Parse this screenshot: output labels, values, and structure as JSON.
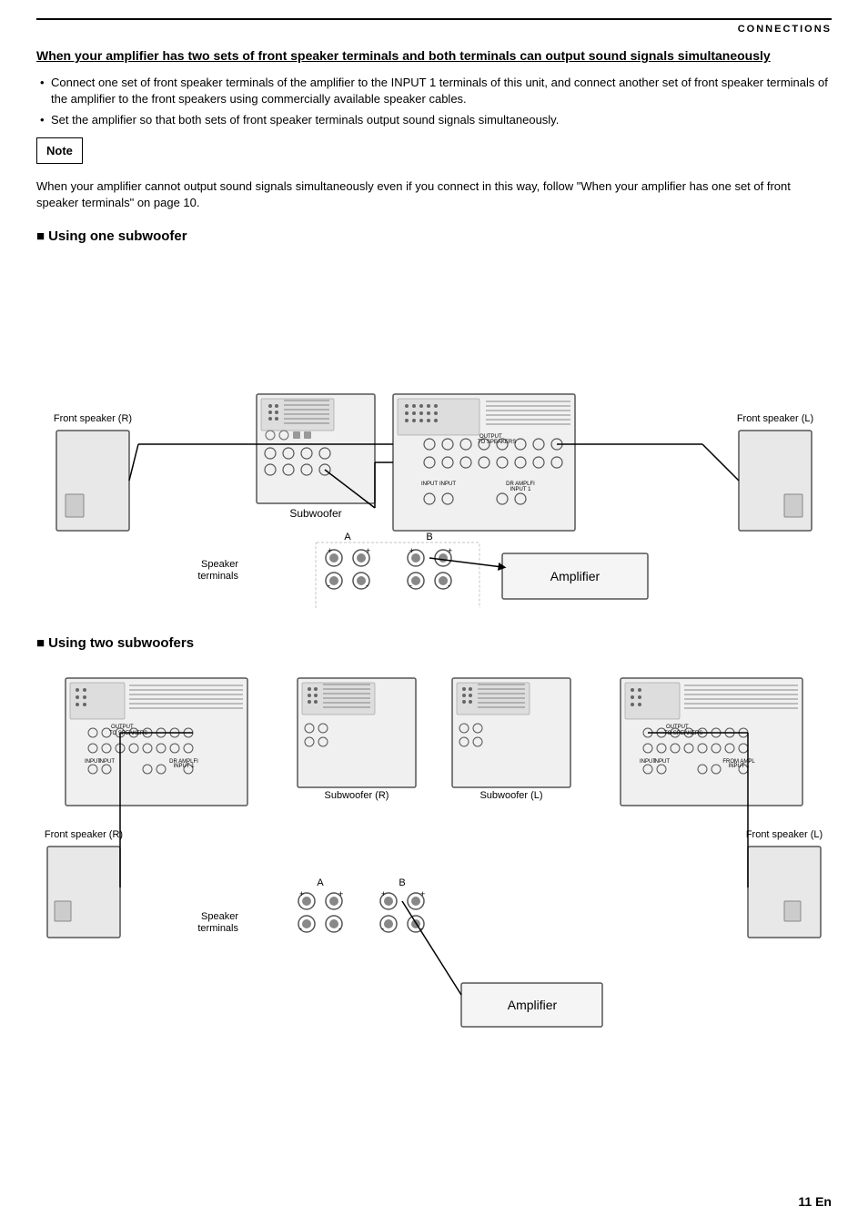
{
  "header": {
    "section": "CONNECTIONS"
  },
  "main_title": "When your amplifier has two sets of front speaker terminals and both terminals can output sound signals simultaneously",
  "bullets": [
    "Connect one set of front speaker terminals of the amplifier to the INPUT 1 terminals of this unit, and connect another set of front speaker terminals of the amplifier to the front speakers using commercially available speaker cables.",
    "Set the amplifier so that both sets of front speaker terminals output sound signals simultaneously."
  ],
  "note": {
    "label": "Note",
    "text": "When your amplifier cannot output sound signals simultaneously even if you connect in this way, follow \"When your amplifier has one set of front speaker terminals\" on page 10."
  },
  "section1": {
    "title": "Using one subwoofer",
    "front_speaker_r": "Front speaker (R)",
    "front_speaker_l": "Front speaker (L)",
    "subwoofer": "Subwoofer",
    "speaker_terminals": "Speaker\nterminals",
    "amplifier": "Amplifier",
    "label_a": "A",
    "label_b": "B"
  },
  "section2": {
    "title": "Using two subwoofers",
    "front_speaker_r": "Front speaker (R)",
    "front_speaker_l": "Front speaker (L)",
    "subwoofer_r": "Subwoofer (R)",
    "subwoofer_l": "Subwoofer (L)",
    "speaker_terminals": "Speaker\nterminals",
    "amplifier": "Amplifier",
    "label_a": "A",
    "label_b": "B"
  },
  "page_number": "11 En"
}
